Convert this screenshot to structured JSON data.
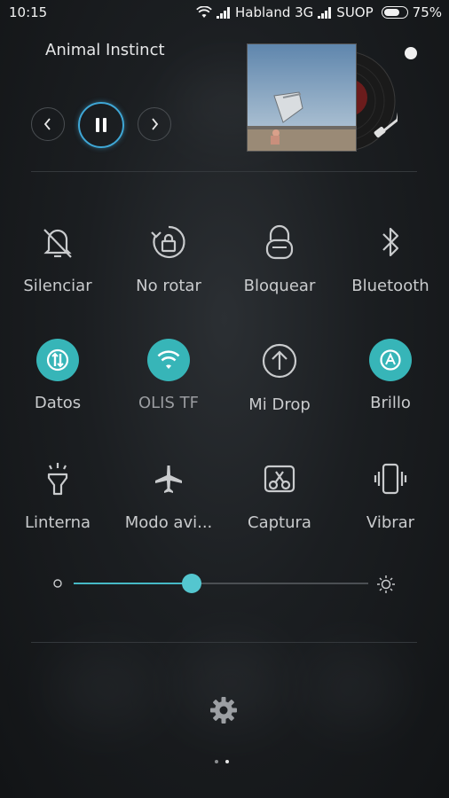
{
  "status_bar": {
    "time": "10:15",
    "carrier1": "Habland 3G",
    "carrier2": "SUOP",
    "battery": "75%",
    "battery_level": 0.75
  },
  "music": {
    "song_title": "Animal Instinct"
  },
  "toggles_row1": [
    {
      "label": "Silenciar",
      "icon": "bell-off-icon"
    },
    {
      "label": "No rotar",
      "icon": "rotation-lock-icon"
    },
    {
      "label": "Bloquear",
      "icon": "lock-icon"
    },
    {
      "label": "Bluetooth",
      "icon": "bluetooth-icon"
    }
  ],
  "toggles_row2": [
    {
      "label": "Datos",
      "icon": "mobile-data-icon",
      "active": true
    },
    {
      "label": "OLIS    TF",
      "icon": "wifi-icon",
      "active": true
    },
    {
      "label": "Mi Drop",
      "icon": "upload-icon",
      "active": false
    },
    {
      "label": "Brillo",
      "icon": "auto-brightness-icon",
      "active": true
    }
  ],
  "toggles_row3": [
    {
      "label": "Linterna",
      "icon": "flashlight-icon"
    },
    {
      "label": "Modo avi...",
      "icon": "airplane-icon"
    },
    {
      "label": "Captura",
      "icon": "screenshot-icon"
    },
    {
      "label": "Vibrar",
      "icon": "vibrate-icon"
    }
  ],
  "brightness": {
    "level": 0.4
  },
  "colors": {
    "accent": "#37b5b8",
    "play_ring": "#3fa7d6"
  },
  "pager": {
    "pages": 2,
    "active": 2
  }
}
